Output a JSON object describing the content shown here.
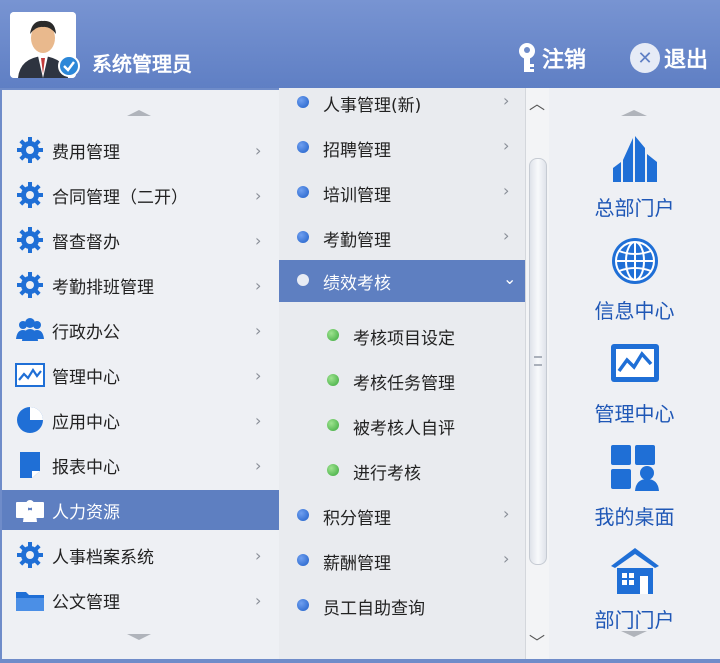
{
  "header": {
    "user_name": "系统管理员",
    "logout_label": "注销",
    "exit_label": "退出"
  },
  "left_menu": {
    "items": [
      {
        "label": "费用管理",
        "icon": "gear-icon"
      },
      {
        "label": "合同管理（二开）",
        "icon": "gear-icon"
      },
      {
        "label": "督查督办",
        "icon": "gear-icon"
      },
      {
        "label": "考勤排班管理",
        "icon": "gear-icon"
      },
      {
        "label": "行政办公",
        "icon": "people-icon"
      },
      {
        "label": "管理中心",
        "icon": "chart-icon"
      },
      {
        "label": "应用中心",
        "icon": "pie-icon"
      },
      {
        "label": "报表中心",
        "icon": "report-icon"
      },
      {
        "label": "人力资源",
        "icon": "hr-icon",
        "active": true
      },
      {
        "label": "人事档案系统",
        "icon": "gear-icon"
      },
      {
        "label": "公文管理",
        "icon": "folder-icon"
      }
    ]
  },
  "mid_menu": {
    "items": [
      {
        "label": "人事管理(新)",
        "has_children": true
      },
      {
        "label": "招聘管理",
        "has_children": true
      },
      {
        "label": "培训管理",
        "has_children": true
      },
      {
        "label": "考勤管理",
        "has_children": true
      },
      {
        "label": "绩效考核",
        "has_children": true,
        "active": true,
        "expanded": true
      },
      {
        "label": "考核项目设定",
        "sub": true
      },
      {
        "label": "考核任务管理",
        "sub": true
      },
      {
        "label": "被考核人自评",
        "sub": true
      },
      {
        "label": "进行考核",
        "sub": true
      },
      {
        "label": "积分管理",
        "has_children": true
      },
      {
        "label": "薪酬管理",
        "has_children": true
      },
      {
        "label": "员工自助查询",
        "has_children": false
      }
    ]
  },
  "right_menu": {
    "items": [
      {
        "label": "总部门户",
        "icon": "buildings-icon"
      },
      {
        "label": "信息中心",
        "icon": "globe-icon"
      },
      {
        "label": "管理中心",
        "icon": "monitor-chart-icon"
      },
      {
        "label": "我的桌面",
        "icon": "desktop-grid-icon"
      },
      {
        "label": "部门门户",
        "icon": "house-icon"
      }
    ]
  },
  "colors": {
    "header_bg": "#6f8cc9",
    "active_bg": "#5e7fc1",
    "icon_blue": "#1f6fd6",
    "link_blue": "#1f57b6"
  }
}
